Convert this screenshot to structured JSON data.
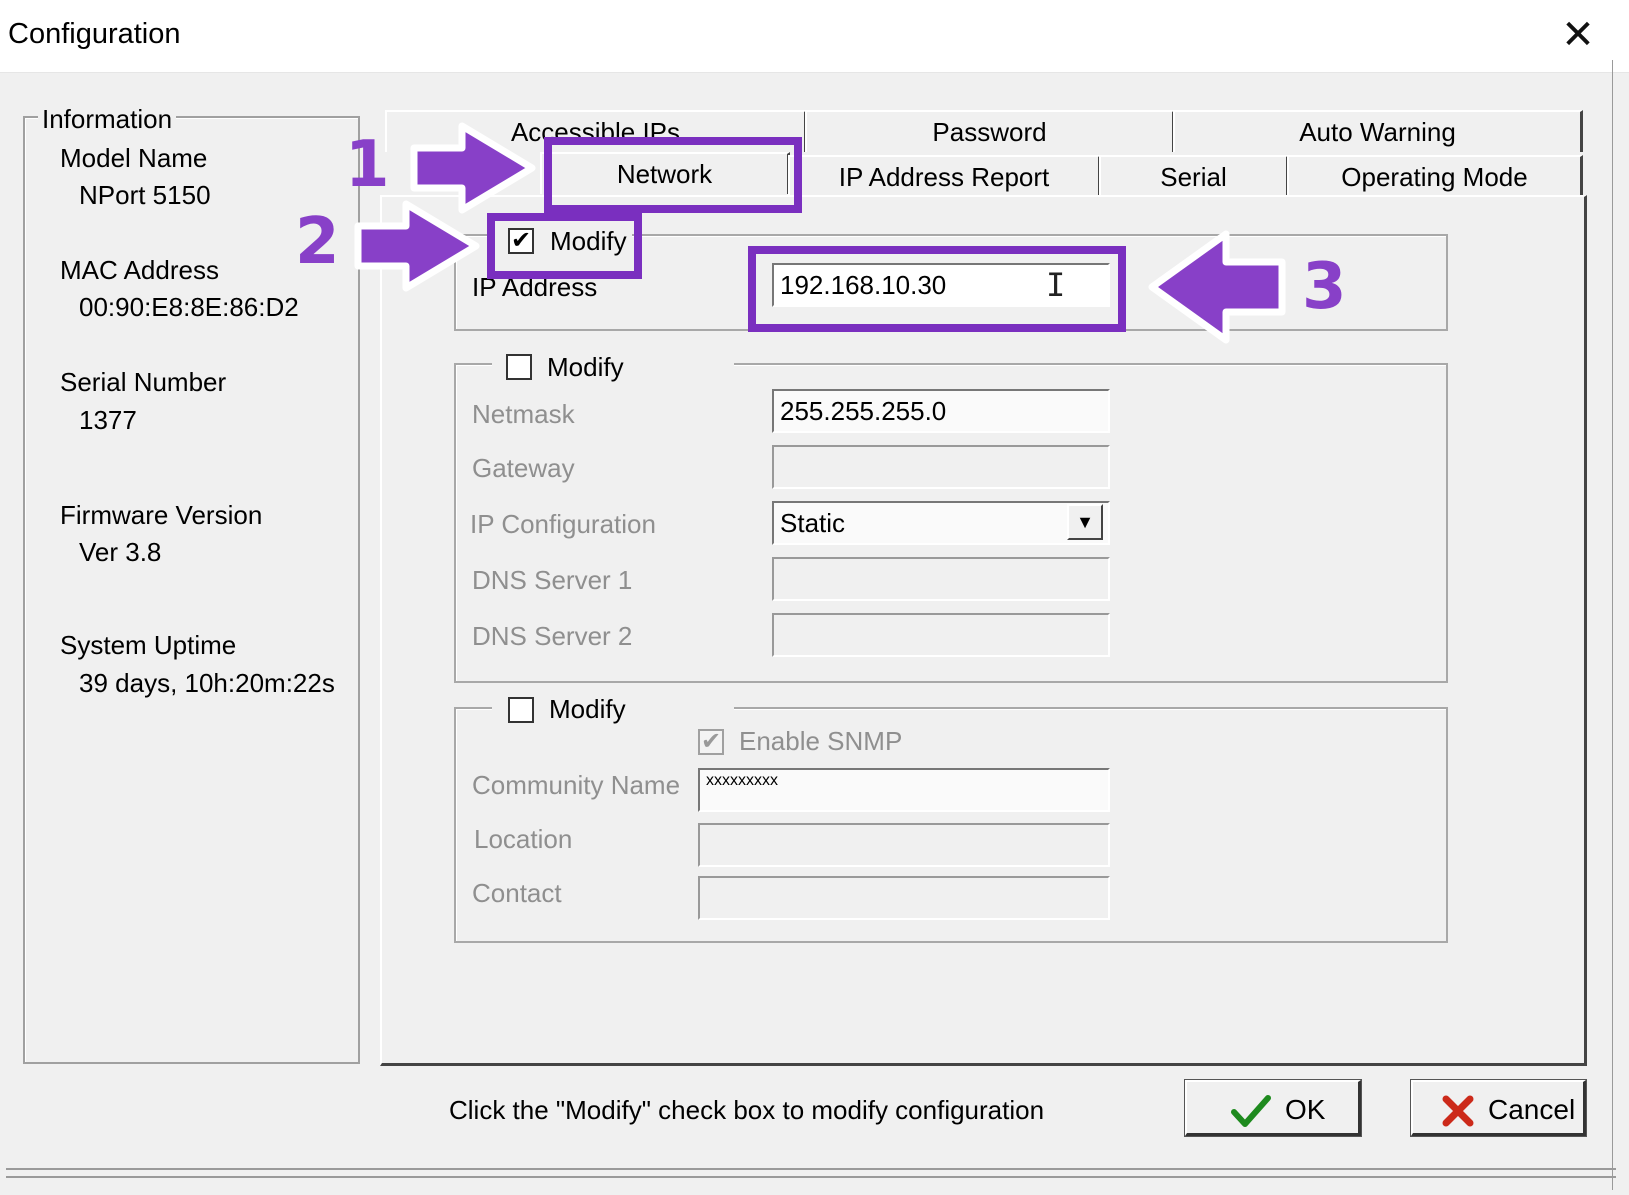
{
  "window": {
    "title": "Configuration",
    "close_glyph": "✕"
  },
  "info": {
    "legend": "Information",
    "model_label": "Model Name",
    "model_value": "NPort 5150",
    "mac_label": "MAC Address",
    "mac_value": "00:90:E8:8E:86:D2",
    "serial_label": "Serial Number",
    "serial_value": "1377",
    "firmware_label": "Firmware Version",
    "firmware_value": "Ver 3.8",
    "uptime_label": "System Uptime",
    "uptime_value": "39 days, 10h:20m:22s"
  },
  "tabs": {
    "row1": [
      "Accessible IPs",
      "Password",
      "Auto Warning"
    ],
    "row2": [
      "Network",
      "IP Address Report",
      "Serial",
      "Operating Mode"
    ],
    "active": "Network"
  },
  "group_ip": {
    "modify_label": "Modify",
    "modify_checked": true,
    "ip_label": "IP Address",
    "ip_value": "192.168.10.30"
  },
  "group_net": {
    "modify_label": "Modify",
    "modify_checked": false,
    "netmask_label": "Netmask",
    "netmask_value": "255.255.255.0",
    "gateway_label": "Gateway",
    "gateway_value": "",
    "ipconf_label": "IP Configuration",
    "ipconf_value": "Static",
    "dns1_label": "DNS Server 1",
    "dns1_value": "",
    "dns2_label": "DNS Server 2",
    "dns2_value": ""
  },
  "group_snmp": {
    "modify_label": "Modify",
    "modify_checked": false,
    "snmp_label": "Enable SNMP",
    "snmp_checked": true,
    "community_label": "Community Name",
    "community_value": "xxxxxxxxx",
    "location_label": "Location",
    "location_value": "",
    "contact_label": "Contact",
    "contact_value": ""
  },
  "status_text": "Click the \"Modify\" check box to modify configuration",
  "buttons": {
    "ok": "OK",
    "cancel": "Cancel"
  },
  "annotations": {
    "step1": "1",
    "step2": "2",
    "step3": "3",
    "color": "#8840c8"
  },
  "icons": {
    "ok": "checkmark-icon",
    "cancel": "x-icon",
    "dropdown": "chevron-down-icon",
    "cursor": "text-cursor-icon"
  }
}
